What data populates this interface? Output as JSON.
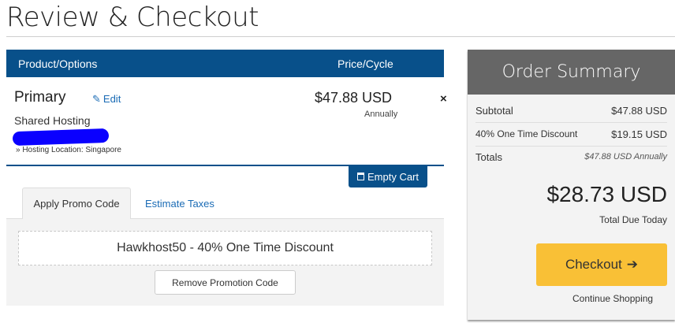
{
  "page": {
    "title": "Review & Checkout"
  },
  "cart": {
    "header": {
      "product": "Product/Options",
      "price": "Price/Cycle"
    },
    "item": {
      "name": "Primary",
      "edit_label": "Edit",
      "group": "Shared Hosting",
      "option": "» Hosting Location: Singapore",
      "price": "$47.88 USD",
      "cycle": "Annually",
      "remove_icon": "×"
    },
    "empty_cart_label": "Empty Cart"
  },
  "promo": {
    "tabs": [
      {
        "label": "Apply Promo Code",
        "active": true
      },
      {
        "label": "Estimate Taxes",
        "active": false
      }
    ],
    "applied_code": "Hawkhost50 - 40% One Time Discount",
    "remove_label": "Remove Promotion Code"
  },
  "summary": {
    "title": "Order Summary",
    "rows": [
      {
        "label": "Subtotal",
        "value": "$47.88 USD"
      },
      {
        "label": "40% One Time Discount",
        "value": "$19.15 USD"
      },
      {
        "label": "Totals",
        "value": "$47.88 USD Annually"
      }
    ],
    "total_due": "$28.73 USD",
    "total_due_label": "Total Due Today",
    "checkout_label": "Checkout",
    "continue_label": "Continue Shopping"
  },
  "colors": {
    "primary": "#08508a",
    "checkout": "#f9c036",
    "summary_header": "#666666",
    "link": "#1a6bb5"
  },
  "icons": [
    "pencil-icon",
    "close-icon",
    "trash-icon",
    "arrow-right-icon"
  ]
}
